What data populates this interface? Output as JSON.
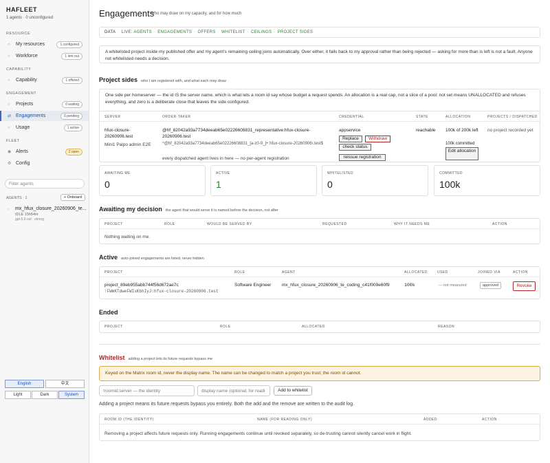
{
  "sidebar": {
    "brand": "HAFLEET",
    "brand_sub": "1 agents · 0 unconfigured",
    "sections": {
      "resource": "RESOURCE",
      "capability": "CAPABILITY",
      "engagement": "ENGAGEMENT",
      "fleet": "FLEET"
    },
    "items": [
      {
        "label": "My resources",
        "pill": "1 configured"
      },
      {
        "label": "Workforce",
        "pill": "1 lent out"
      },
      {
        "label": "Capability",
        "pill": "1 offered"
      },
      {
        "label": "Projects",
        "pill": "0 waiting"
      },
      {
        "label": "Engagements",
        "pill": "0 pending"
      },
      {
        "label": "Usage",
        "pill": "1 active"
      },
      {
        "label": "Alerts",
        "pill": "2 open"
      },
      {
        "label": "Config",
        "pill": ""
      }
    ],
    "filter_placeholder": "Filter agents",
    "agents_label": "AGENTS · 1",
    "onboard_label": "+ Onboard",
    "agent": {
      "name": "mx_hfux_closure_20260906_te...",
      "meta": "IDLE 15h54m",
      "model": "gpt-5.6-sol · strong"
    },
    "lang": {
      "english": "English",
      "chinese": "中文"
    },
    "theme": {
      "light": "Light",
      "dark": "Dark",
      "system": "System"
    }
  },
  "header": {
    "title": "Engagements",
    "subtitle": "Who may draw on my capacity, and for how much"
  },
  "databar": {
    "data": "DATA",
    "links": [
      "LIVE: AGENTS",
      "ENGAGEMENTS",
      "OFFERS",
      "WHITELIST",
      "CEILINGS",
      "PROJECT SIDES"
    ]
  },
  "intro": "A whitelisted project inside my published offer and my agent's remaining ceiling joins automatically. Over either, it falls back to my approval rather than being rejected — asking for more than is left is not a fault. Anyone not whitelisted needs a decision.",
  "project_sides": {
    "title": "Project sides",
    "subtitle": "who I am registered with, and what each may draw",
    "note": "One side per homeserver — the id IS the server name, which is what lets a room id say whose budget a request spends. An allocation is a real cap, not a slice of a pool: not set means UNALLOCATED and refuses everything, and zero is a deliberate close that leaves the side configured.",
    "columns": [
      "SERVER",
      "ORDER-TAKER",
      "CREDENTIAL",
      "STATE",
      "ALLOCATION",
      "PROJECTS / DISPATCHED"
    ],
    "row": {
      "server": "hfux-closure-20260906.test",
      "server_sub": "Mini1 Palpo admin E2E",
      "order_taker": "@hf_82042a93a7734deeab65e02226608831_representative:hfux-closure-20260906.test",
      "order_regex": "^@hf_82042a93a7734deeab65e02226608831_[a-z0-9_]+:hfux-closure-20260906\\.test$",
      "order_note": "every dispatched agent lives in here — no per-agent registration",
      "credential": "appservice",
      "btn_replace": "Replace",
      "btn_withdraw": "Withdraw",
      "btn_check": "check status",
      "btn_reissue": "reissue registration",
      "state": "reachable",
      "allocation": "100k of 200k left",
      "allocation_committed": "100k committed",
      "btn_edit": "Edit allocation",
      "projects": "no project recorded yet"
    }
  },
  "stats": [
    {
      "label": "AWAITING ME",
      "value": "0"
    },
    {
      "label": "ACTIVE",
      "value": "1"
    },
    {
      "label": "WHITELISTED",
      "value": "0"
    },
    {
      "label": "COMMITTED",
      "value": "100k"
    }
  ],
  "awaiting": {
    "title": "Awaiting my decision",
    "subtitle": "the agent that would serve it is named before the decision, not after",
    "columns": [
      "PROJECT",
      "ROLE",
      "WOULD BE SERVED BY",
      "REQUESTED",
      "WHY IT NEEDS ME",
      "ACTION"
    ],
    "empty": "Nothing waiting on me."
  },
  "active": {
    "title": "Active",
    "subtitle": "auto-joined engagements are listed, never hidden",
    "columns": [
      "PROJECT",
      "ROLE",
      "AGENT",
      "ALLOCATED",
      "USED",
      "JOINED VIA",
      "ACTION"
    ],
    "row": {
      "project": "project_89eb955abb744f56d672ae7c",
      "project_room": "!FWmKTdweFWIsKbhIyJ:hfux-closure-20260906.test",
      "role": "Software Engineer",
      "agent": "mx_hfux_closure_20260906_te_coding_c41f009e60f9",
      "allocated": "100k",
      "used": "— not measured",
      "joined": "approved",
      "action": "Revoke"
    }
  },
  "ended": {
    "title": "Ended",
    "columns": [
      "PROJECT",
      "ROLE",
      "ALLOCATED",
      "REASON"
    ]
  },
  "whitelist": {
    "title": "Whitelist",
    "subtitle": "adding a project lets its future requests bypass me",
    "warning": "Keyed on the Matrix room id, never the display name. The name can be changed to match a project you trust; the room id cannot.",
    "room_placeholder": "!roomid:server — the identity",
    "name_placeholder": "display name (optional, for readi",
    "add_label": "Add to whitelist",
    "note": "Adding a project means its future requests bypass you entirely. Both the add and the remove are written to the audit log.",
    "columns": [
      "ROOM ID (THE IDENTITY)",
      "NAME (FOR READING ONLY)",
      "ADDED",
      "ACTION"
    ],
    "footer": "Removing a project affects future requests only. Running engagements continue until revoked separately, so de-trusting cannot silently cancel work in flight."
  }
}
